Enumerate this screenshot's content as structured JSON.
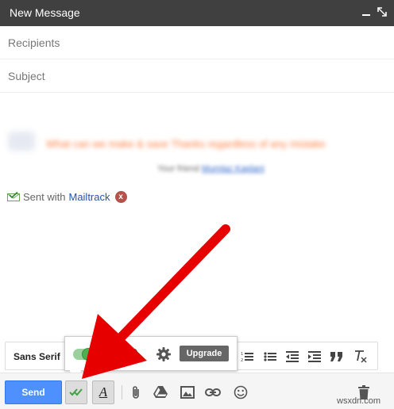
{
  "window": {
    "title": "New Message"
  },
  "fields": {
    "recipients_placeholder": "Recipients",
    "subject_placeholder": "Subject"
  },
  "body": {
    "blurred_headline": "What can we make & save Thanks regardless of any mistake",
    "blurred_line_prefix": "Your friend",
    "blurred_link": "Mumtaz Kaplani",
    "signature_prefix": "Sent with",
    "signature_link": "Mailtrack",
    "signature_badge": "x"
  },
  "formatting": {
    "font_label": "Sans Serif"
  },
  "popup": {
    "upgrade_label": "Upgrade"
  },
  "toolbar": {
    "send_label": "Send"
  },
  "watermark": "wsxdn.com",
  "colors": {
    "titlebar": "#404040",
    "send": "#4d90fe",
    "arrow": "#e60000",
    "toggle": "#4caf50"
  }
}
